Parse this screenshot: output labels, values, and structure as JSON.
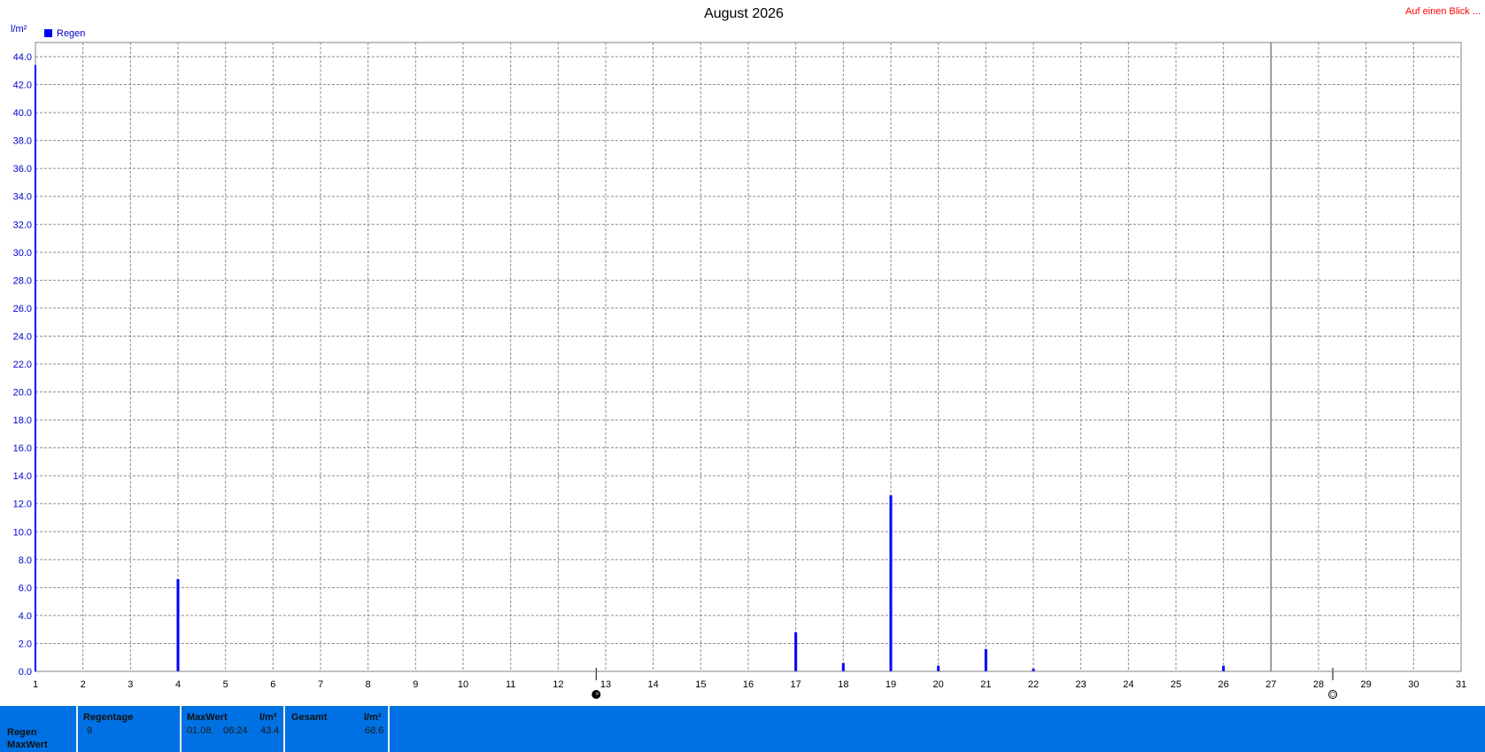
{
  "top_link": "Auf einen Blick ...",
  "chart_data": {
    "type": "bar",
    "title": "August 2026",
    "y_unit": "l/m²",
    "ylim": [
      0,
      44
    ],
    "y_ticks": [
      "0.0",
      "2.0",
      "4.0",
      "6.0",
      "8.0",
      "10.0",
      "12.0",
      "14.0",
      "16.0",
      "18.0",
      "20.0",
      "22.0",
      "24.0",
      "26.0",
      "28.0",
      "30.0",
      "32.0",
      "34.0",
      "36.0",
      "38.0",
      "40.0",
      "42.0",
      "44.0"
    ],
    "x_ticks": [
      "1",
      "2",
      "3",
      "4",
      "5",
      "6",
      "7",
      "8",
      "9",
      "10",
      "11",
      "12",
      "13",
      "14",
      "15",
      "16",
      "17",
      "18",
      "19",
      "20",
      "21",
      "22",
      "23",
      "24",
      "25",
      "26",
      "27",
      "28",
      "29",
      "30",
      "31"
    ],
    "xlim": [
      1,
      31
    ],
    "grid": true,
    "legend_position": "top-left",
    "series": [
      {
        "name": "Regen",
        "color": "#0000ff",
        "points": [
          {
            "x": 1,
            "y": 43.4
          },
          {
            "x": 4,
            "y": 6.6
          },
          {
            "x": 17,
            "y": 2.8
          },
          {
            "x": 18,
            "y": 0.6
          },
          {
            "x": 19,
            "y": 12.6
          },
          {
            "x": 20,
            "y": 0.4
          },
          {
            "x": 21,
            "y": 1.6
          },
          {
            "x": 22,
            "y": 0.2
          },
          {
            "x": 26,
            "y": 0.4
          }
        ]
      }
    ],
    "today_marker_x": 27,
    "moon_phases": [
      {
        "icon": "full-moon-icon",
        "x": 12.8
      },
      {
        "icon": "new-moon-icon",
        "x": 28.3
      }
    ]
  },
  "summary": {
    "row_labels": [
      "Regen",
      "MaxWert"
    ],
    "regentage": {
      "label": "Regentage",
      "value": "9"
    },
    "maxwert": {
      "label": "MaxWert",
      "unit": "l/m²",
      "date": "01.08.",
      "time": "06:24",
      "value": "43.4"
    },
    "gesamt": {
      "label": "Gesamt",
      "unit": "l/m²",
      "value": "68.6"
    },
    "bar_color": "#0071e3"
  }
}
